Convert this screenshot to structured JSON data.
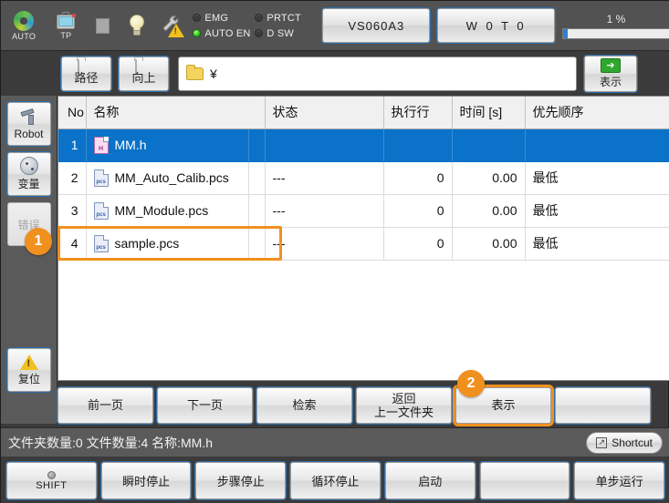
{
  "topbar": {
    "mode_label": "AUTO",
    "tp_label": "TP",
    "leds": [
      {
        "name": "EMG",
        "on": false
      },
      {
        "name": "PRTCT",
        "on": false
      },
      {
        "name": "AUTO EN",
        "on": true
      },
      {
        "name": "D SW",
        "on": false
      }
    ],
    "model_label": "VS060A3",
    "program_label": "W 0 T 0",
    "progress_text": "1 %",
    "progress_percent": 4
  },
  "pathrow": {
    "path_button_label": "路径",
    "up_button_label": "向上",
    "path_value": "¥",
    "path_placeholder": "",
    "display_button_label": "表示"
  },
  "sidebar": {
    "items": [
      {
        "label": "Robot",
        "icon": "robot-arm-icon",
        "disabled": false
      },
      {
        "label": "变量",
        "icon": "variable-icon",
        "disabled": false
      },
      {
        "label": "错误",
        "icon": "error-icon",
        "disabled": true
      }
    ],
    "reset": {
      "label": "复位",
      "icon": "warning-triangle-icon"
    }
  },
  "badges": [
    {
      "id": "1",
      "text": "1"
    },
    {
      "id": "2",
      "text": "2"
    }
  ],
  "table": {
    "columns": [
      "No",
      "名称",
      "",
      "状态",
      "执行行",
      "时间 [s]",
      "优先顺序"
    ],
    "rows": [
      {
        "no": "1",
        "name": "MM.h",
        "icon_tag": "H",
        "icon_kind": "h",
        "flag": "",
        "state": "",
        "exec_line": "",
        "time": "",
        "priority": "",
        "selected": true,
        "framed": false
      },
      {
        "no": "2",
        "name": "MM_Auto_Calib.pcs",
        "icon_tag": "pcs",
        "icon_kind": "pcs",
        "flag": "",
        "state": "---",
        "exec_line": "0",
        "time": "0.00",
        "priority": "最低",
        "selected": false,
        "framed": false
      },
      {
        "no": "3",
        "name": "MM_Module.pcs",
        "icon_tag": "pcs",
        "icon_kind": "pcs",
        "flag": "",
        "state": "---",
        "exec_line": "0",
        "time": "0.00",
        "priority": "最低",
        "selected": false,
        "framed": false
      },
      {
        "no": "4",
        "name": "sample.pcs",
        "icon_tag": "pcs",
        "icon_kind": "pcs",
        "flag": "",
        "state": "---",
        "exec_line": "0",
        "time": "0.00",
        "priority": "最低",
        "selected": false,
        "framed": true
      }
    ]
  },
  "actions": [
    {
      "label_top": "前一页",
      "label_bottom": ""
    },
    {
      "label_top": "下一页",
      "label_bottom": ""
    },
    {
      "label_top": "检索",
      "label_bottom": ""
    },
    {
      "label_top": "返回",
      "label_bottom": "上一文件夹"
    },
    {
      "label_top": "表示",
      "label_bottom": "",
      "highlighted": true
    },
    {
      "label_top": "",
      "label_bottom": ""
    }
  ],
  "statusbar": {
    "text": "文件夹数量:0  文件数量:4  名称:MM.h",
    "shortcut_label": "Shortcut"
  },
  "fkeys": [
    {
      "label": "SHIFT",
      "has_led": true
    },
    {
      "label": "瞬时停止",
      "has_led": false
    },
    {
      "label": "步骤停止",
      "has_led": false
    },
    {
      "label": "循环停止",
      "has_led": false
    },
    {
      "label": "启动",
      "has_led": false
    },
    {
      "label": "",
      "has_led": false
    },
    {
      "label": "单步运行",
      "has_led": false
    }
  ],
  "colors": {
    "accent_blue": "#0a72c8",
    "highlight_orange": "#f0901e",
    "led_green": "#22c014",
    "panel_gray": "#525252"
  }
}
